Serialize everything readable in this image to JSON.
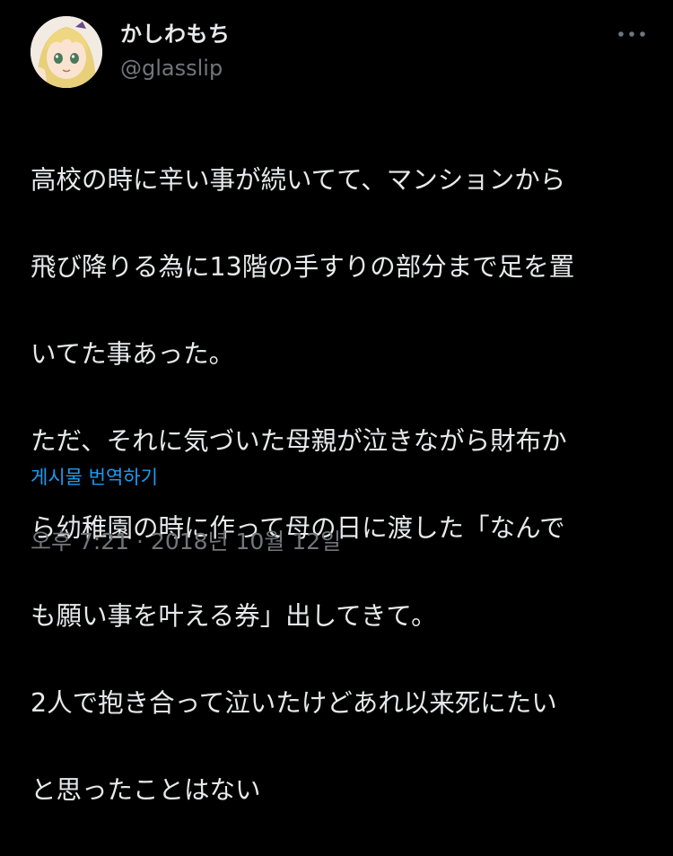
{
  "author": {
    "display_name": "かしわもち",
    "handle": "@glasslip",
    "avatar_icon": "anime-avatar-icon"
  },
  "menu": {
    "more_icon": "more-horizontal-icon"
  },
  "post": {
    "lines": [
      "高校の時に辛い事が続いてて、マンションから",
      "飛び降りる為に13階の手すりの部分まで足を置",
      "いてた事あった。",
      "ただ、それに気づいた母親が泣きながら財布か",
      "ら幼稚園の時に作って母の日に渡した「なんで",
      "も願い事を叶える券」出してきて。",
      "2人で抱き合って泣いたけどあれ以来死にたい",
      "と思ったことはない"
    ],
    "translate_label": "게시물 번역하기",
    "timestamp": "오후 7:21 · 2018년 10월 12일"
  },
  "colors": {
    "background": "#000000",
    "text": "#e7e9ea",
    "muted": "#71767b",
    "link": "#1d9bf0"
  }
}
